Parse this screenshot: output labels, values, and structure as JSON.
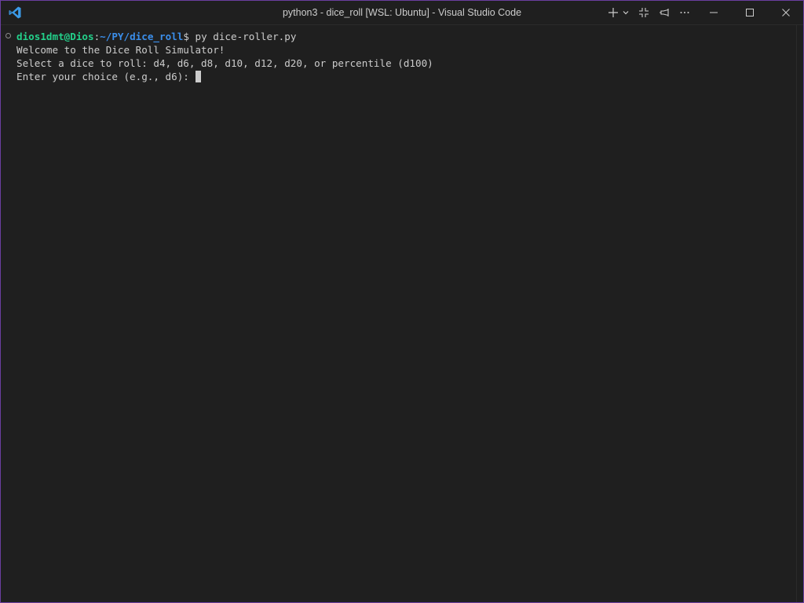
{
  "window": {
    "title": "python3 - dice_roll [WSL: Ubuntu] - Visual Studio Code",
    "accent_border": "#6b3fa0"
  },
  "titlebar_icons": {
    "logo": "vscode-logo-icon",
    "new_terminal": "plus-icon",
    "dropdown": "chevron-down-icon",
    "restore_panel": "collapse-panel-icon",
    "pin": "pin-icon",
    "more": "ellipsis-icon",
    "minimize": "minimize-icon",
    "maximize": "maximize-icon",
    "close": "close-icon"
  },
  "terminal": {
    "prompt": {
      "user_host": "dios1dmt@Dios",
      "sep": ":",
      "path": "~/PY/dice_roll",
      "dollar": "$",
      "command": " py dice-roller.py"
    },
    "lines": [
      "Welcome to the Dice Roll Simulator!",
      "Select a dice to roll: d4, d6, d8, d10, d12, d20, or percentile (d100)",
      "Enter your choice (e.g., d6): "
    ],
    "colors": {
      "user_host": "#23d18b",
      "path": "#3b8eea",
      "text": "#cccccc",
      "background": "#1f1f1f"
    }
  }
}
